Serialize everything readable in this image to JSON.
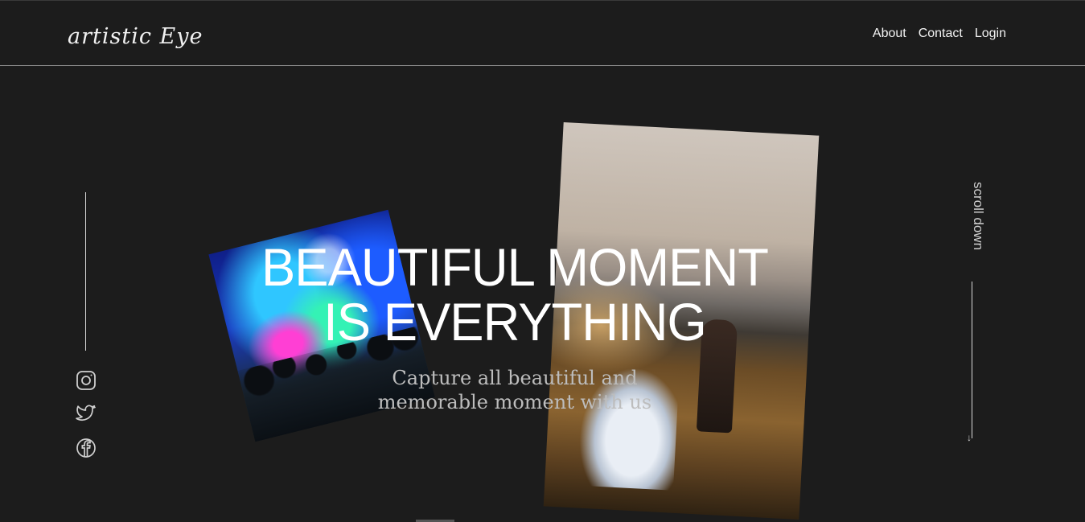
{
  "brand": {
    "logo_text": "artistic Eye"
  },
  "nav": {
    "items": [
      "About",
      "Contact",
      "Login"
    ]
  },
  "hero": {
    "headline_line1": "BEAUTIFUL MOMENT",
    "headline_line2": "IS EVERYTHING",
    "subtitle_line1": "Capture all beautiful and",
    "subtitle_line2": "memorable moment with us"
  },
  "scroll": {
    "label": "scroll down"
  },
  "social": [
    {
      "icon": "instagram-icon"
    },
    {
      "icon": "twitter-icon"
    },
    {
      "icon": "facebook-icon"
    }
  ],
  "colors": {
    "background": "#1c1c1c",
    "text": "#ffffff",
    "muted": "#bdbdbd"
  }
}
